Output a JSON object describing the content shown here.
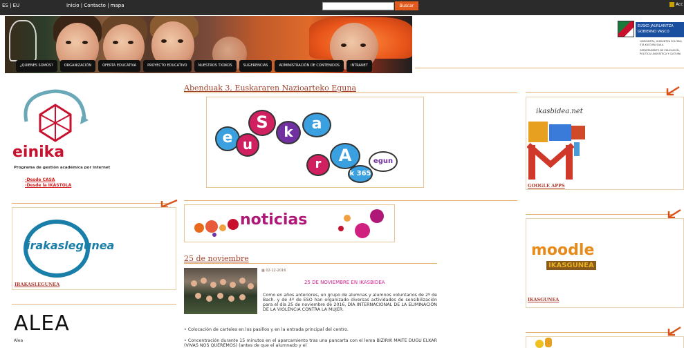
{
  "topbar": {
    "lang": "ES | EU",
    "links": "Inicio | Contacto | mapa",
    "search_button": "Buscar",
    "access_label": "Acc"
  },
  "nav": {
    "items": [
      {
        "label": "¿QUIENES SOMOS?"
      },
      {
        "label": "ORGANIZACIÓN"
      },
      {
        "label": "OFERTA EDUCATIVA"
      },
      {
        "label": "PROYECTO EDUCATIVO"
      },
      {
        "label": "NUESTROS TXOKOS"
      },
      {
        "label": "SUGERENCIAS"
      },
      {
        "label": "ADMINISTRACIÓN DE CONTENIDOS"
      },
      {
        "label": "INTRANET"
      }
    ]
  },
  "gov": {
    "line1": "EUSKO JAURLARITZA",
    "line2": "GOBIERNO VASCO",
    "dept1": "HEZKUNTZA, HIZKUNTZA POLITIKA ETA KULTURA SAILA",
    "dept2": "DEPARTAMENTO DE EDUCACIÓN, POLÍTICA LINGÜÍSTICA Y CULTURA"
  },
  "left": {
    "einika_word": "einika",
    "einika_title": "Programa de gestión académica por internet",
    "link_casa": "-Desde CASA",
    "link_ikastola": "-Desde la IKASTOLA",
    "irak_logo_text": "irakaslegunea",
    "irak_caption": "IRAKASLEGUNEA",
    "alea_word": "ALEA",
    "alea_sub": "Alea"
  },
  "center": {
    "article1_title": "Abenduak 3, Euskararen Nazioarteko Eguna",
    "euskara_letters": [
      "e",
      "u",
      "S",
      "k",
      "a",
      "r",
      "A"
    ],
    "euskara_k365": "k 365",
    "euskara_egun": "egun",
    "noticias_word": "noticias",
    "article2_title": "25 de noviembre",
    "date": "02-12-2016",
    "news_head": "25 DE NOVIEMBRE EN   IKASBIDEA",
    "para1": "Como en años anteriores, un grupo de alumnas y alumnos voluntarios de 2º de Bach. y de 4º de ESO han organizado diversas actividades de sensibilización para el día 25 de noviembre de 2016, DÍA INTERNACIONAL DE LA ELIMINACIÓN DE LA VIOLENCIA CONTRA LA MUJER.",
    "bullet1": "•   Colocación de carteles en los pasillos y en la entrada principal del centro.",
    "bullet2": "•   Concentración durante 15 minutos en el aparcamiento tras una pancarta con el lema BIZIRIK MAITE DUGU ELKAR (VIVAS NOS QUEREMOS) (antes de que el alumnado y el"
  },
  "right": {
    "ikasbidea_word": "ikasbidea.net",
    "gapps_caption": "GOOGLE APPS",
    "moodle_word": "moodle",
    "moodle_sub": "IKASGUNEA",
    "ikasgunea_caption": "IKASGUNEA"
  }
}
